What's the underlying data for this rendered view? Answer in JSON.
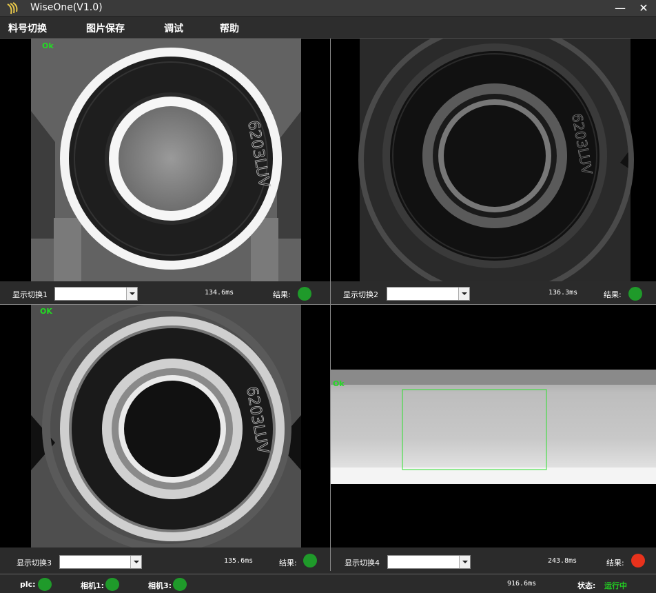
{
  "window": {
    "title": "WiseOne(V1.0)",
    "minimize": "—",
    "close": "✕"
  },
  "menu": [
    "料号切换",
    "图片保存",
    "调试",
    "帮助"
  ],
  "panels": [
    {
      "ok": "Ok",
      "switch_label": "显示切换1",
      "selected": "",
      "time": "134.6ms",
      "result_label": "结果:",
      "result_color": "#1f9a2a"
    },
    {
      "ok": "",
      "switch_label": "显示切换2",
      "selected": "",
      "time": "136.3ms",
      "result_label": "结果:",
      "result_color": "#1f9a2a"
    },
    {
      "ok": "OK",
      "switch_label": "显示切换3",
      "selected": "",
      "time": "135.6ms",
      "result_label": "结果:",
      "result_color": "#1f9a2a"
    },
    {
      "ok": "Ok",
      "switch_label": "显示切换4",
      "selected": "",
      "time": "243.8ms",
      "result_label": "结果:",
      "result_color": "#e8321c"
    }
  ],
  "bearing_text": "6203LUV",
  "status": {
    "plc_label": "plc:",
    "cam1_label": "相机1:",
    "cam3_label": "相机3:",
    "total_time": "916.6ms",
    "state_label": "状态:",
    "state_value": "运行中",
    "led_color": "#1f9a2a",
    "state_color": "#22cc22"
  }
}
